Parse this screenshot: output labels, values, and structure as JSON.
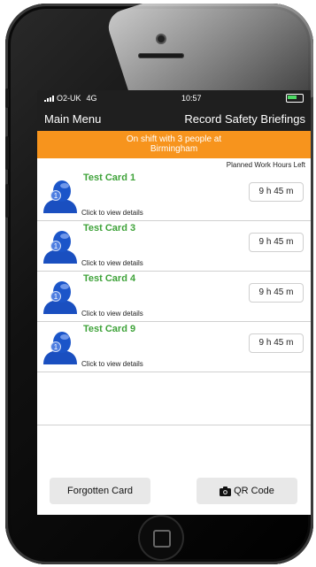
{
  "status_bar": {
    "carrier": "O2-UK",
    "network": "4G",
    "time": "10:57"
  },
  "nav": {
    "back_label": "Main Menu",
    "title": "Record Safety Briefings"
  },
  "shift": {
    "line1": "On shift with 3 people at",
    "line2": "Birmingham"
  },
  "list_header": "Planned Work Hours Left",
  "cards": [
    {
      "name": "Test Card 1",
      "details": "Click to view details",
      "hours": "9 h 45 m"
    },
    {
      "name": "Test Card 3",
      "details": "Click to view details",
      "hours": "9 h 45 m"
    },
    {
      "name": "Test Card 4",
      "details": "Click to view details",
      "hours": "9 h 45 m"
    },
    {
      "name": "Test Card 9",
      "details": "Click to view details",
      "hours": "9 h 45 m"
    }
  ],
  "buttons": {
    "forgotten": "Forgotten Card",
    "qr": "QR Code"
  },
  "colors": {
    "accent_orange": "#f7941d",
    "name_green": "#3fa33a",
    "bar_dark": "#1f1f1f",
    "avatar_blue": "#1b55c9"
  },
  "icons": [
    "signal-icon",
    "battery-icon",
    "user-avatar-icon",
    "camera-icon"
  ]
}
